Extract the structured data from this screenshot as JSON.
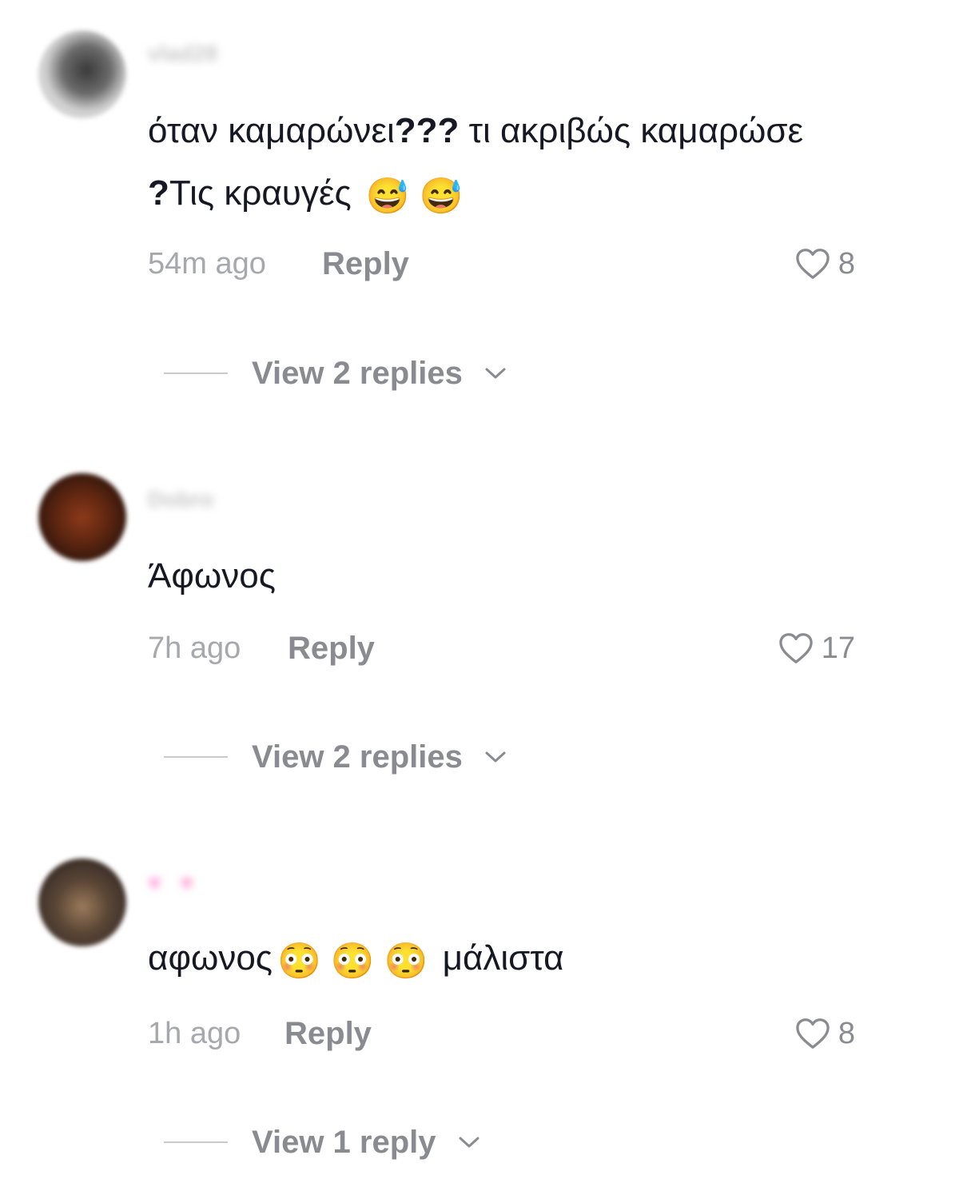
{
  "comments": [
    {
      "username": "vlad28",
      "text_parts": [
        "όταν καμαρώνει",
        "???",
        " τι ακριβώς καμαρώσε",
        "?",
        "Τις κραυγές "
      ],
      "emojis": [
        "😅",
        "😅"
      ],
      "time": "54m ago",
      "reply_label": "Reply",
      "likes": "8",
      "view_replies": "View 2 replies"
    },
    {
      "username": "Dobro",
      "text": "Άφωνος",
      "time": "7h ago",
      "reply_label": "Reply",
      "likes": "17",
      "view_replies": "View 2 replies"
    },
    {
      "username": "♥ ♥",
      "text_before": "αφωνος",
      "emojis": [
        "😳",
        "😳",
        "😳"
      ],
      "text_after": " μάλιστα",
      "time": "1h ago",
      "reply_label": "Reply",
      "likes": "8",
      "view_replies": "View 1 reply"
    }
  ],
  "colors": {
    "text": "#161823",
    "muted": "#a7a8ad",
    "action": "#8a8b91"
  },
  "icons": [
    "heart-outline-icon",
    "chevron-down-icon"
  ]
}
